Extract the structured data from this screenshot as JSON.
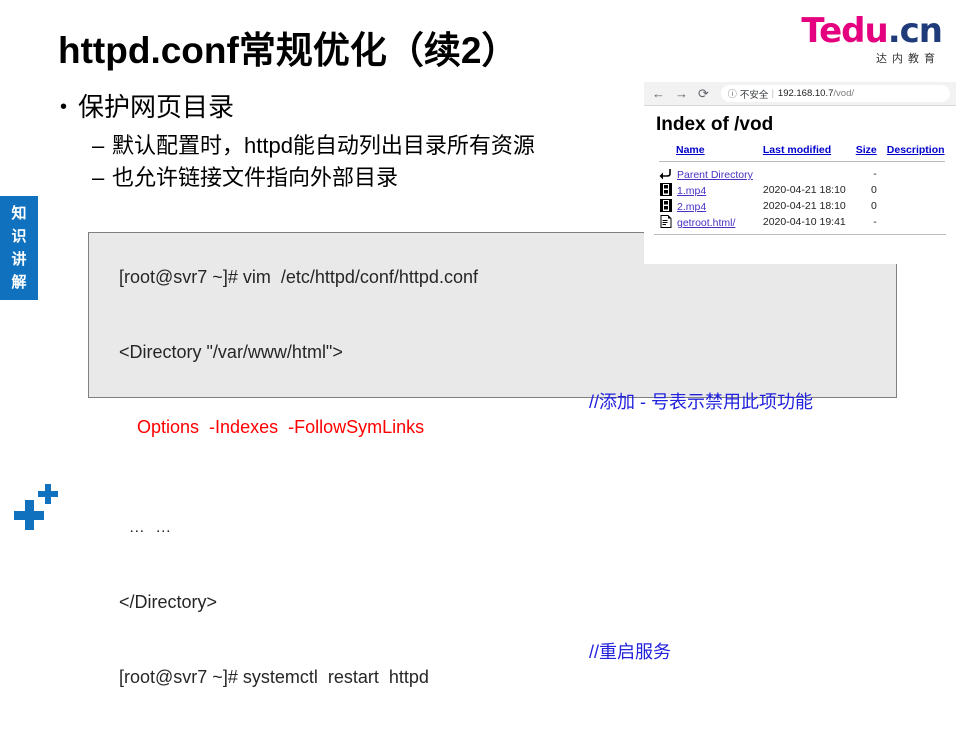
{
  "logo": {
    "part1": "T",
    "part2": "edu",
    "part3": ".cn",
    "subtitle": "达内教育",
    "brand_magenta": "#e4007f",
    "brand_blue": "#1f3b7a"
  },
  "slide": {
    "title": "httpd.conf常规优化（续2）",
    "accent_color": "#1072bf"
  },
  "side_tag": {
    "chars": [
      "知",
      "识",
      "讲",
      "解"
    ],
    "background": "#1072bf"
  },
  "bullets": {
    "level1_marker": "•",
    "level2_marker": "–",
    "level1": "保护网页目录",
    "level2": [
      "默认配置时，httpd能自动列出目录所有资源",
      "也允许链接文件指向外部目录"
    ]
  },
  "code_block": {
    "background": "#e9e9e9",
    "border_color": "#808080",
    "text_color": "#262626",
    "highlight_color": "#ff0000",
    "comment_color": "#2222dd",
    "lines": [
      {
        "text": "[root@svr7 ~]# vim  /etc/httpd/conf/httpd.conf",
        "comment": ""
      },
      {
        "text": "<Directory \"/var/www/html\">",
        "comment": ""
      },
      {
        "text": "Options  -Indexes  -FollowSymLinks",
        "comment": "//添加 - 号表示禁用此项功能"
      },
      {
        "text": "… …",
        "comment": ""
      },
      {
        "text": "</Directory>",
        "comment": ""
      },
      {
        "text": "[root@svr7 ~]# systemctl  restart  httpd",
        "comment": "//重启服务"
      }
    ]
  },
  "browser": {
    "nav": {
      "back": "←",
      "forward": "→",
      "reload": "⟳"
    },
    "omnibox": {
      "info_icon": "ⓘ",
      "security_label": "不安全",
      "separator": "|",
      "host": "192.168.10.7",
      "path": "/vod/"
    },
    "page": {
      "heading": "Index of /vod",
      "columns": [
        "Name",
        "Last modified",
        "Size",
        "Description"
      ],
      "rows": [
        {
          "icon": "parent-directory-icon",
          "name": "Parent Directory",
          "modified": "",
          "size": "-",
          "description": ""
        },
        {
          "icon": "video-file-icon",
          "name": "1.mp4",
          "modified": "2020-04-21 18:10",
          "size": "0",
          "description": ""
        },
        {
          "icon": "video-file-icon",
          "name": "2.mp4",
          "modified": "2020-04-21 18:10",
          "size": "0",
          "description": ""
        },
        {
          "icon": "html-file-icon",
          "name": "getroot.html/",
          "modified": "2020-04-10 19:41",
          "size": "-",
          "description": ""
        }
      ]
    }
  }
}
